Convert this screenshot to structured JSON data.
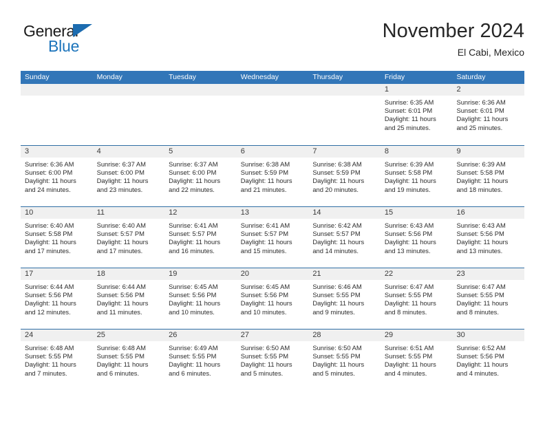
{
  "logo": {
    "primary_text": "General",
    "secondary_text": "Blue",
    "triangle_color": "#1c6cb0",
    "secondary_color": "#1c74bb"
  },
  "header": {
    "title": "November 2024",
    "subtitle": "El Cabi, Mexico"
  },
  "theme": {
    "header_blue": "#3276b8",
    "row_divider": "#2e6da4",
    "day_strip_gray": "#f0f0f0"
  },
  "weekdays": [
    "Sunday",
    "Monday",
    "Tuesday",
    "Wednesday",
    "Thursday",
    "Friday",
    "Saturday"
  ],
  "weeks": [
    [
      {
        "empty": true
      },
      {
        "empty": true
      },
      {
        "empty": true
      },
      {
        "empty": true
      },
      {
        "empty": true
      },
      {
        "date": "1",
        "sunrise": "Sunrise: 6:35 AM",
        "sunset": "Sunset: 6:01 PM",
        "daylight_1": "Daylight: 11 hours",
        "daylight_2": "and 25 minutes."
      },
      {
        "date": "2",
        "sunrise": "Sunrise: 6:36 AM",
        "sunset": "Sunset: 6:01 PM",
        "daylight_1": "Daylight: 11 hours",
        "daylight_2": "and 25 minutes."
      }
    ],
    [
      {
        "date": "3",
        "sunrise": "Sunrise: 6:36 AM",
        "sunset": "Sunset: 6:00 PM",
        "daylight_1": "Daylight: 11 hours",
        "daylight_2": "and 24 minutes."
      },
      {
        "date": "4",
        "sunrise": "Sunrise: 6:37 AM",
        "sunset": "Sunset: 6:00 PM",
        "daylight_1": "Daylight: 11 hours",
        "daylight_2": "and 23 minutes."
      },
      {
        "date": "5",
        "sunrise": "Sunrise: 6:37 AM",
        "sunset": "Sunset: 6:00 PM",
        "daylight_1": "Daylight: 11 hours",
        "daylight_2": "and 22 minutes."
      },
      {
        "date": "6",
        "sunrise": "Sunrise: 6:38 AM",
        "sunset": "Sunset: 5:59 PM",
        "daylight_1": "Daylight: 11 hours",
        "daylight_2": "and 21 minutes."
      },
      {
        "date": "7",
        "sunrise": "Sunrise: 6:38 AM",
        "sunset": "Sunset: 5:59 PM",
        "daylight_1": "Daylight: 11 hours",
        "daylight_2": "and 20 minutes."
      },
      {
        "date": "8",
        "sunrise": "Sunrise: 6:39 AM",
        "sunset": "Sunset: 5:58 PM",
        "daylight_1": "Daylight: 11 hours",
        "daylight_2": "and 19 minutes."
      },
      {
        "date": "9",
        "sunrise": "Sunrise: 6:39 AM",
        "sunset": "Sunset: 5:58 PM",
        "daylight_1": "Daylight: 11 hours",
        "daylight_2": "and 18 minutes."
      }
    ],
    [
      {
        "date": "10",
        "sunrise": "Sunrise: 6:40 AM",
        "sunset": "Sunset: 5:58 PM",
        "daylight_1": "Daylight: 11 hours",
        "daylight_2": "and 17 minutes."
      },
      {
        "date": "11",
        "sunrise": "Sunrise: 6:40 AM",
        "sunset": "Sunset: 5:57 PM",
        "daylight_1": "Daylight: 11 hours",
        "daylight_2": "and 17 minutes."
      },
      {
        "date": "12",
        "sunrise": "Sunrise: 6:41 AM",
        "sunset": "Sunset: 5:57 PM",
        "daylight_1": "Daylight: 11 hours",
        "daylight_2": "and 16 minutes."
      },
      {
        "date": "13",
        "sunrise": "Sunrise: 6:41 AM",
        "sunset": "Sunset: 5:57 PM",
        "daylight_1": "Daylight: 11 hours",
        "daylight_2": "and 15 minutes."
      },
      {
        "date": "14",
        "sunrise": "Sunrise: 6:42 AM",
        "sunset": "Sunset: 5:57 PM",
        "daylight_1": "Daylight: 11 hours",
        "daylight_2": "and 14 minutes."
      },
      {
        "date": "15",
        "sunrise": "Sunrise: 6:43 AM",
        "sunset": "Sunset: 5:56 PM",
        "daylight_1": "Daylight: 11 hours",
        "daylight_2": "and 13 minutes."
      },
      {
        "date": "16",
        "sunrise": "Sunrise: 6:43 AM",
        "sunset": "Sunset: 5:56 PM",
        "daylight_1": "Daylight: 11 hours",
        "daylight_2": "and 13 minutes."
      }
    ],
    [
      {
        "date": "17",
        "sunrise": "Sunrise: 6:44 AM",
        "sunset": "Sunset: 5:56 PM",
        "daylight_1": "Daylight: 11 hours",
        "daylight_2": "and 12 minutes."
      },
      {
        "date": "18",
        "sunrise": "Sunrise: 6:44 AM",
        "sunset": "Sunset: 5:56 PM",
        "daylight_1": "Daylight: 11 hours",
        "daylight_2": "and 11 minutes."
      },
      {
        "date": "19",
        "sunrise": "Sunrise: 6:45 AM",
        "sunset": "Sunset: 5:56 PM",
        "daylight_1": "Daylight: 11 hours",
        "daylight_2": "and 10 minutes."
      },
      {
        "date": "20",
        "sunrise": "Sunrise: 6:45 AM",
        "sunset": "Sunset: 5:56 PM",
        "daylight_1": "Daylight: 11 hours",
        "daylight_2": "and 10 minutes."
      },
      {
        "date": "21",
        "sunrise": "Sunrise: 6:46 AM",
        "sunset": "Sunset: 5:55 PM",
        "daylight_1": "Daylight: 11 hours",
        "daylight_2": "and 9 minutes."
      },
      {
        "date": "22",
        "sunrise": "Sunrise: 6:47 AM",
        "sunset": "Sunset: 5:55 PM",
        "daylight_1": "Daylight: 11 hours",
        "daylight_2": "and 8 minutes."
      },
      {
        "date": "23",
        "sunrise": "Sunrise: 6:47 AM",
        "sunset": "Sunset: 5:55 PM",
        "daylight_1": "Daylight: 11 hours",
        "daylight_2": "and 8 minutes."
      }
    ],
    [
      {
        "date": "24",
        "sunrise": "Sunrise: 6:48 AM",
        "sunset": "Sunset: 5:55 PM",
        "daylight_1": "Daylight: 11 hours",
        "daylight_2": "and 7 minutes."
      },
      {
        "date": "25",
        "sunrise": "Sunrise: 6:48 AM",
        "sunset": "Sunset: 5:55 PM",
        "daylight_1": "Daylight: 11 hours",
        "daylight_2": "and 6 minutes."
      },
      {
        "date": "26",
        "sunrise": "Sunrise: 6:49 AM",
        "sunset": "Sunset: 5:55 PM",
        "daylight_1": "Daylight: 11 hours",
        "daylight_2": "and 6 minutes."
      },
      {
        "date": "27",
        "sunrise": "Sunrise: 6:50 AM",
        "sunset": "Sunset: 5:55 PM",
        "daylight_1": "Daylight: 11 hours",
        "daylight_2": "and 5 minutes."
      },
      {
        "date": "28",
        "sunrise": "Sunrise: 6:50 AM",
        "sunset": "Sunset: 5:55 PM",
        "daylight_1": "Daylight: 11 hours",
        "daylight_2": "and 5 minutes."
      },
      {
        "date": "29",
        "sunrise": "Sunrise: 6:51 AM",
        "sunset": "Sunset: 5:55 PM",
        "daylight_1": "Daylight: 11 hours",
        "daylight_2": "and 4 minutes."
      },
      {
        "date": "30",
        "sunrise": "Sunrise: 6:52 AM",
        "sunset": "Sunset: 5:56 PM",
        "daylight_1": "Daylight: 11 hours",
        "daylight_2": "and 4 minutes."
      }
    ]
  ]
}
